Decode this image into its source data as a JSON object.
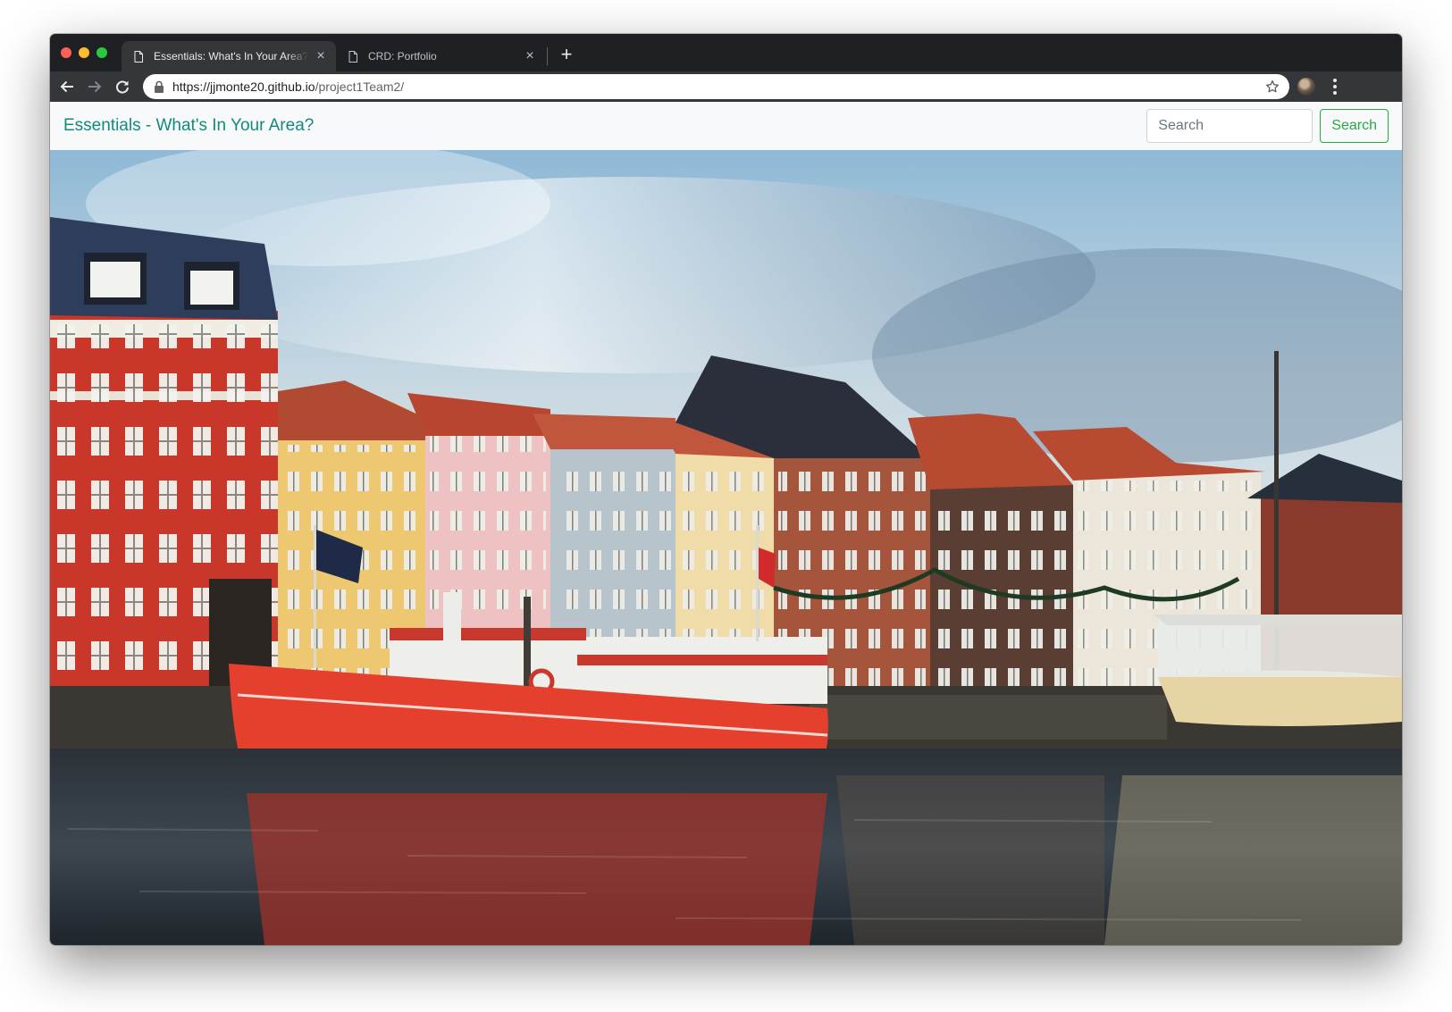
{
  "browser": {
    "tabs": [
      {
        "title": "Essentials: What's In Your Area?",
        "active": true
      },
      {
        "title": "CRD: Portfolio",
        "active": false
      }
    ],
    "url": {
      "scheme": "https://",
      "host": "jjmonte20.github.io",
      "path": "/project1Team2/"
    },
    "icons": {
      "back": "arrow-left-icon",
      "forward": "arrow-right-icon",
      "reload": "reload-icon",
      "lock": "lock-icon",
      "bookmark": "star-icon",
      "menu": "kebab-menu-icon",
      "new_tab": "plus-icon",
      "close": "close-icon"
    }
  },
  "page": {
    "navbar": {
      "brand": "Essentials - What's In Your Area?",
      "search_placeholder": "Search",
      "search_button": "Search"
    },
    "colors": {
      "brand": "#138a7e",
      "button_outline": "#28a745",
      "navbar_bg": "#f8f9fa"
    }
  }
}
